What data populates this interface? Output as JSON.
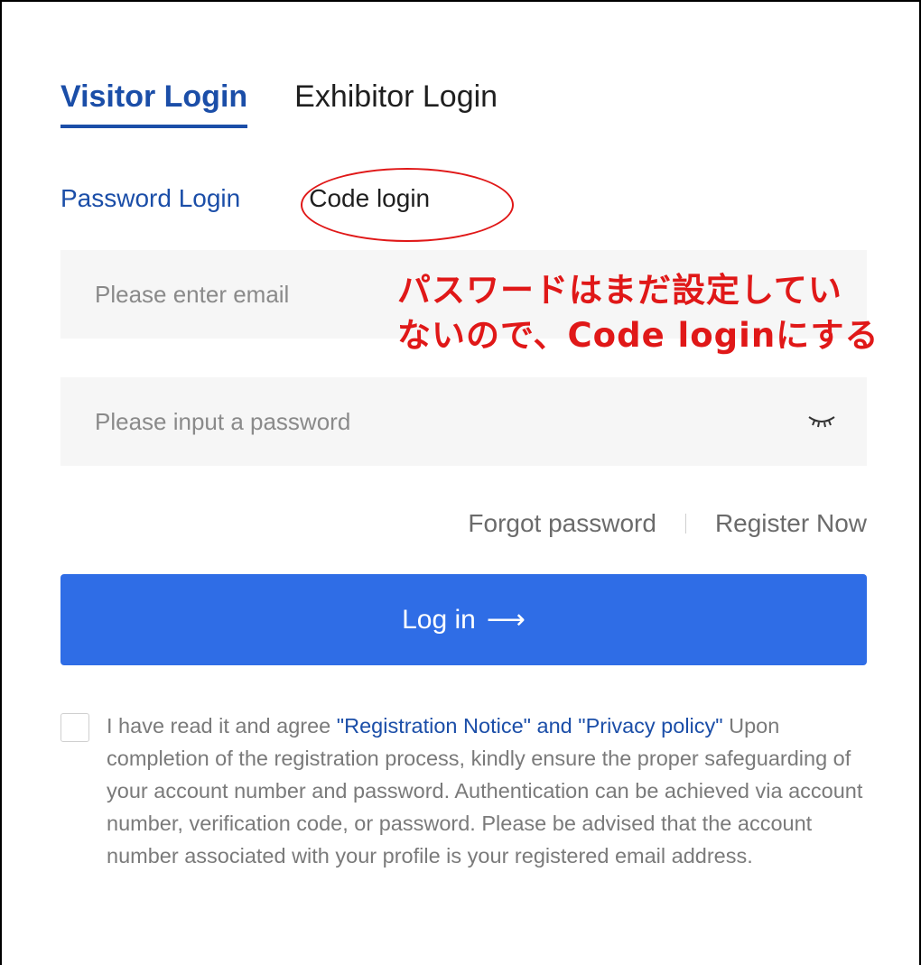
{
  "role_tabs": {
    "visitor": "Visitor Login",
    "exhibitor": "Exhibitor Login"
  },
  "method_tabs": {
    "password": "Password Login",
    "code": "Code login"
  },
  "fields": {
    "email_placeholder": "Please enter email",
    "password_placeholder": "Please input a password"
  },
  "annotation": {
    "line1": "パスワードはまだ設定してい",
    "line2": "ないので、Code loginにする"
  },
  "links": {
    "forgot": "Forgot password",
    "register": "Register Now"
  },
  "login_button": {
    "label": "Log in",
    "arrow": "⟶"
  },
  "agreement": {
    "prefix": "I have read it and agree ",
    "notice": "\"Registration Notice\"",
    "and": " and ",
    "policy": "\"Privacy policy\"",
    "body": "Upon completion of the registration process, kindly ensure the proper safeguarding of your account number and password. Authentication can be achieved via account number, verification code, or password. Please be advised that the account number associated with your profile is your registered email address."
  },
  "colors": {
    "primary": "#2f6de6",
    "active_tab": "#1b4ea8",
    "annotation": "#e01818"
  },
  "icons": {
    "password_toggle": "eye-closed-icon"
  }
}
